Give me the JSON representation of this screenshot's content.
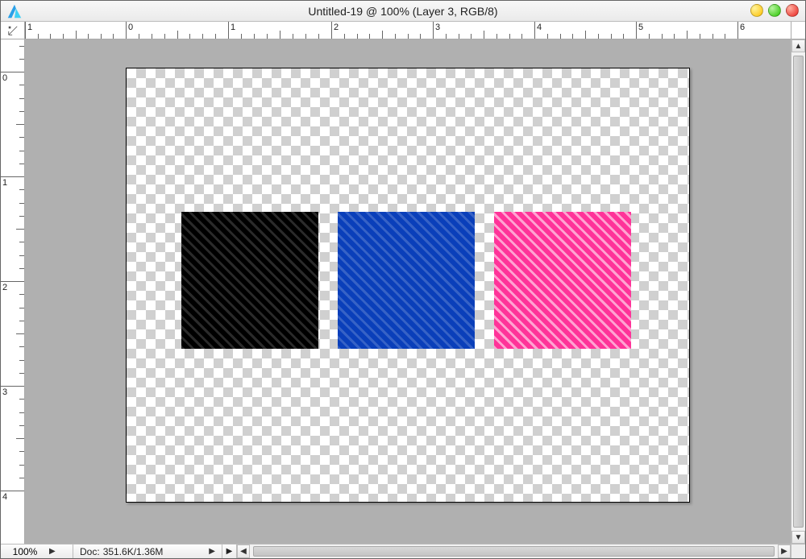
{
  "window": {
    "title": "Untitled-19 @ 100% (Layer 3, RGB/8)"
  },
  "status": {
    "zoom": "100%",
    "doc_label_prefix": "Doc:",
    "doc_size": "351.6K/1.36M"
  },
  "ruler": {
    "h_labels": [
      "1",
      "0",
      "1",
      "2",
      "3",
      "4",
      "5",
      "6"
    ],
    "v_labels": [
      "0",
      "1",
      "2",
      "3",
      "4"
    ]
  },
  "canvas": {
    "squares": [
      {
        "color": "#000000",
        "name": "black"
      },
      {
        "color": "#0a3fba",
        "name": "blue"
      },
      {
        "color": "#ff3399",
        "name": "pink"
      }
    ]
  },
  "icons": {
    "chev_up": "▲",
    "chev_down": "▼",
    "chev_left": "◀",
    "chev_right": "▶"
  }
}
